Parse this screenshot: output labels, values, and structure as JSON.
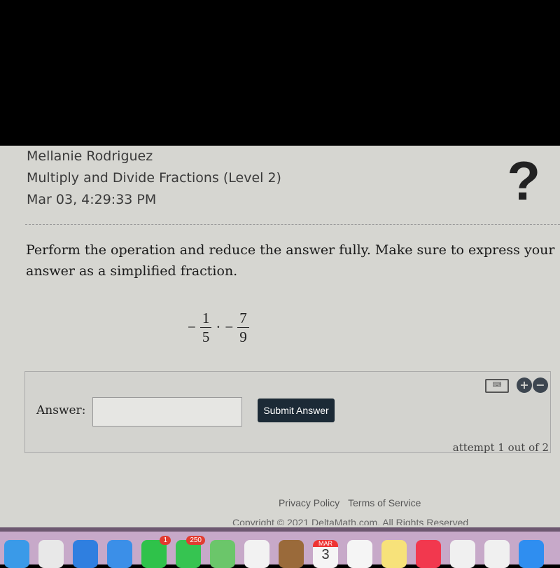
{
  "header": {
    "student": "Mellanie Rodriguez",
    "assignment": "Multiply and Divide Fractions (Level 2)",
    "datetime": "Mar 03, 4:29:33 PM",
    "help_icon": "?"
  },
  "problem": {
    "prompt": "Perform the operation and reduce the answer fully. Make sure to express your answer as a simplified fraction.",
    "expression": {
      "f1_sign": "−",
      "f1_num": "1",
      "f1_den": "5",
      "op": "·",
      "f2_sign": "−",
      "f2_num": "7",
      "f2_den": "9"
    }
  },
  "answer": {
    "label": "Answer:",
    "value": "",
    "submit_label": "Submit Answer",
    "attempt": "attempt 1 out of 2",
    "keyboard_icon": "keyboard-icon",
    "plus": "+",
    "minus": "−"
  },
  "footer": {
    "privacy": "Privacy Policy",
    "terms": "Terms of Service",
    "copyright": "Copyright © 2021 DeltaMath.com. All Rights Reserved"
  },
  "dock": {
    "apps": [
      {
        "name": "finder",
        "color": "#3a9ae8"
      },
      {
        "name": "launchpad",
        "color": "#e8e8e8"
      },
      {
        "name": "safari",
        "color": "#2f7fe0"
      },
      {
        "name": "mail",
        "color": "#3b8fe8"
      },
      {
        "name": "facetime",
        "color": "#2fc24a",
        "badge": "1"
      },
      {
        "name": "messages",
        "color": "#36c451",
        "badge": "250"
      },
      {
        "name": "maps",
        "color": "#6bc66a"
      },
      {
        "name": "photos",
        "color": "#f2f2f2"
      },
      {
        "name": "contacts",
        "color": "#9a6a3a"
      },
      {
        "name": "calendar",
        "color": "#f5f5f5",
        "month": "MAR",
        "day": "3"
      },
      {
        "name": "reminders",
        "color": "#f5f5f5"
      },
      {
        "name": "notes",
        "color": "#f7e27a"
      },
      {
        "name": "music",
        "color": "#f2384e"
      },
      {
        "name": "keynote",
        "color": "#f0f0f0"
      },
      {
        "name": "pages",
        "color": "#f0f0f0"
      },
      {
        "name": "app-store",
        "color": "#2f8ef0"
      }
    ]
  }
}
